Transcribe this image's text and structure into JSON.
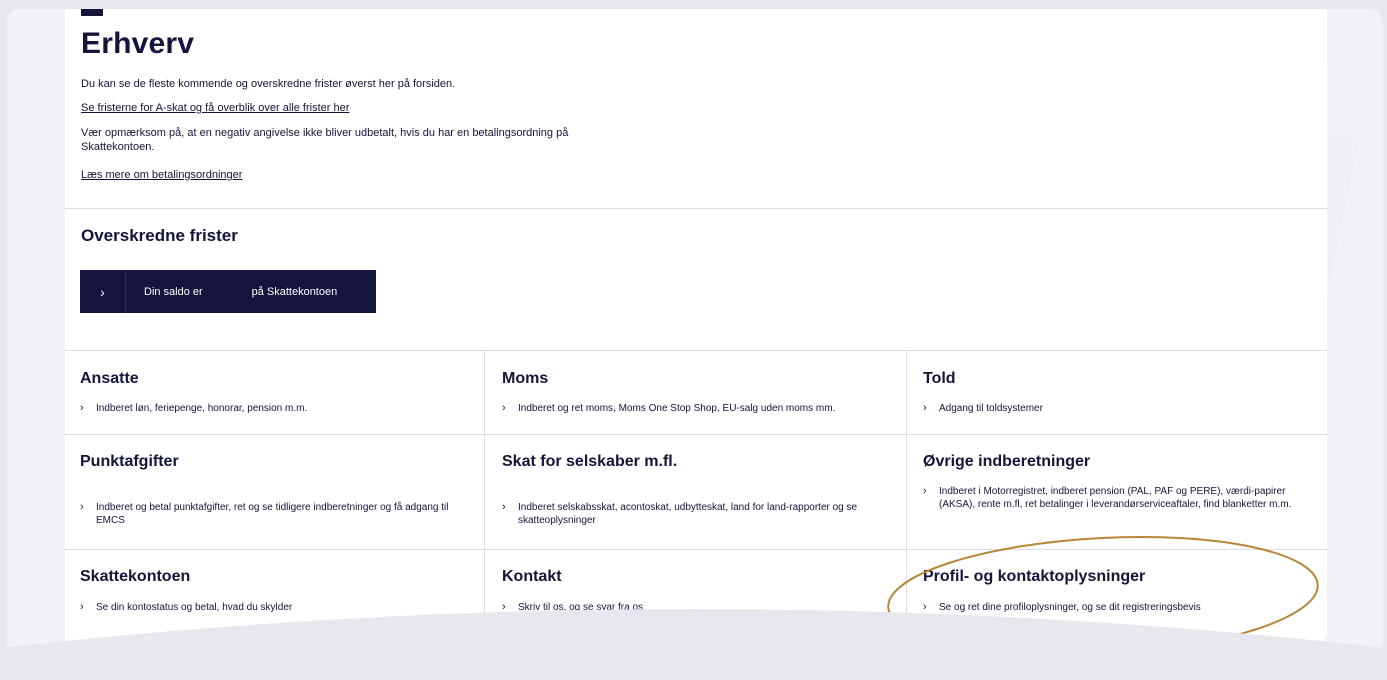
{
  "page": {
    "title": "Erhverv",
    "intro_text_1": "Du kan se de fleste kommende og overskredne frister øverst her på forsiden.",
    "intro_link_1": "Se fristerne for A-skat og få overblik over alle frister her",
    "intro_text_2": "Vær opmærksom på, at en negativ angivelse ikke bliver udbetalt, hvis du har en betalingsordning på Skattekontoen.",
    "intro_link_2": "Læs mere om betalingsordninger"
  },
  "overdue": {
    "title": "Overskredne frister",
    "button_chevron": "›",
    "button_label": "Din saldo er                på Skattekontoen"
  },
  "grid": [
    {
      "title": "Ansatte",
      "chevron": "›",
      "link": "Indberet løn, feriepenge, honorar, pension m.m."
    },
    {
      "title": "Moms",
      "chevron": "›",
      "link": "Indberet og ret moms, Moms One Stop Shop, EU-salg uden moms mm."
    },
    {
      "title": "Told",
      "chevron": "›",
      "link": "Adgang til toldsystemer"
    },
    {
      "title": "Punktafgifter",
      "chevron": "›",
      "link": "Indberet og betal punktafgifter, ret og se tidligere indberetninger og få adgang til EMCS"
    },
    {
      "title": "Skat for selskaber m.fl.",
      "chevron": "›",
      "link": "Indberet selskabsskat, acontoskat, udbytteskat, land for land-rapporter og se skatteoplysninger"
    },
    {
      "title": "Øvrige indberetninger",
      "chevron": "›",
      "link": "Indberet i Motorregistret, indberet pension (PAL, PAF og PERE), værdi-papirer (AKSA), rente m.fl, ret betalinger i leverandørserviceaftaler, find blanketter m.m."
    },
    {
      "title": "Skattekontoen",
      "chevron": "›",
      "link": "Se din kontostatus og betal, hvad du skylder"
    },
    {
      "title": "Kontakt",
      "chevron": "›",
      "link": "Skriv til os, og se svar fra os"
    },
    {
      "title": "Profil- og kontaktoplysninger",
      "chevron": "›",
      "link": "Se og ret dine profiloplysninger, og se dit registreringsbevis"
    }
  ],
  "colors": {
    "brand_navy": "#14143c",
    "highlight_ring": "#b8863a",
    "divider": "#dcdce4"
  }
}
